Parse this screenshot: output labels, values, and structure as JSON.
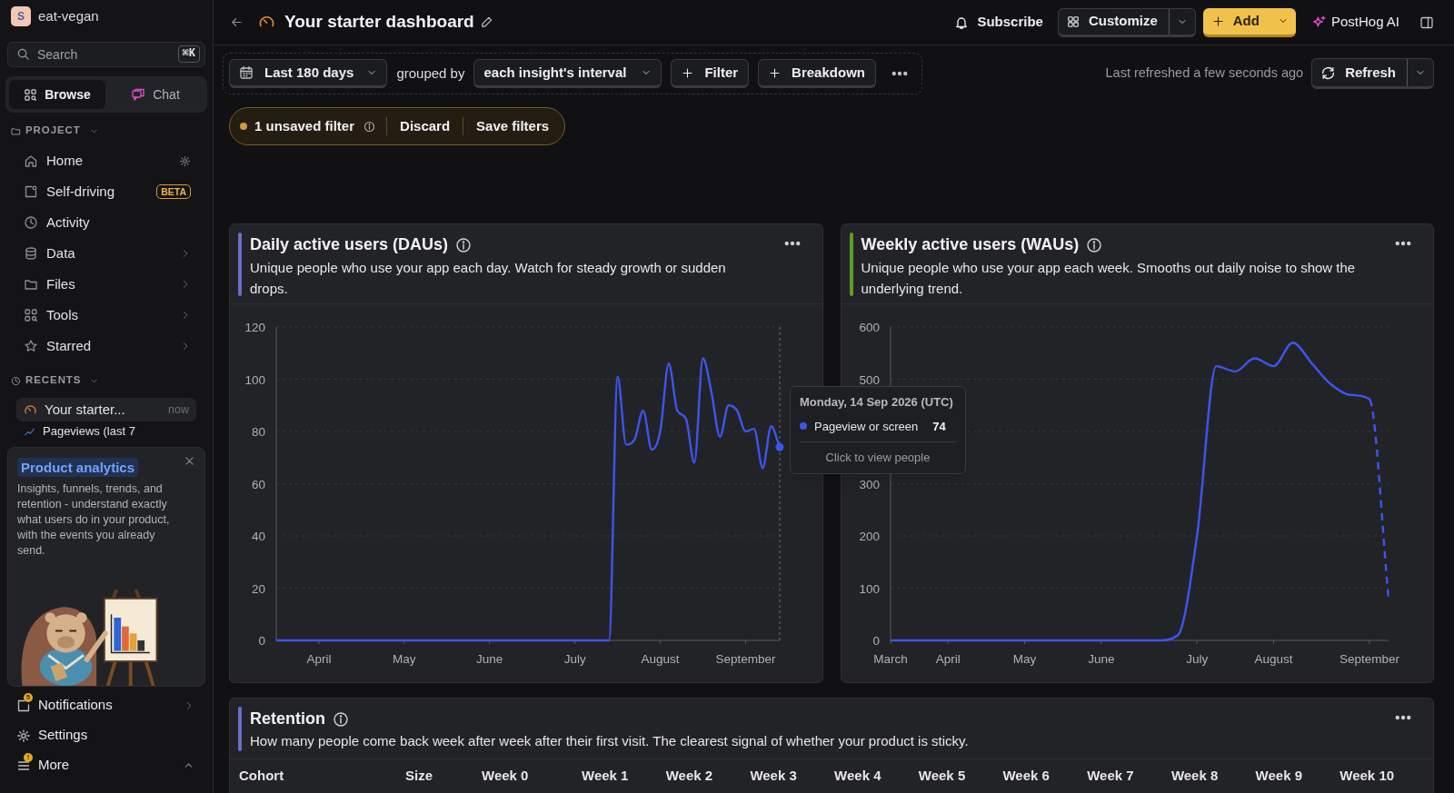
{
  "workspace": {
    "initial": "S",
    "name": "eat-vegan"
  },
  "search": {
    "placeholder": "Search",
    "shortcut": "⌘K"
  },
  "modes": [
    {
      "label": "Browse",
      "selected": true
    },
    {
      "label": "Chat",
      "selected": false
    }
  ],
  "project": {
    "label": "PROJECT",
    "expanded": true,
    "items": [
      {
        "label": "Home",
        "settings": true
      },
      {
        "label": "Self-driving",
        "badge": "BETA"
      },
      {
        "label": "Activity"
      },
      {
        "label": "Data",
        "submenu": true
      },
      {
        "label": "Files",
        "submenu": true
      },
      {
        "label": "Tools",
        "submenu": true
      },
      {
        "label": "Starred",
        "submenu": true
      }
    ]
  },
  "recents": {
    "label": "RECENTS",
    "expanded": true,
    "items": [
      {
        "label": "Your starter...",
        "time": "now",
        "selected": true
      },
      {
        "label": "Pageviews (last 7",
        "selected": false
      }
    ]
  },
  "promo": {
    "tag": "Product analytics",
    "text": "Insights, funnels, trends, and retention - understand exactly what users do in your product, with the events you already send."
  },
  "footer": [
    {
      "label": "Notifications",
      "badge": "5",
      "submenu": true
    },
    {
      "label": "Settings"
    },
    {
      "label": "More",
      "badge": "!",
      "expanded": true
    }
  ],
  "header": {
    "title": "Your starter dashboard",
    "subscribe": "Subscribe",
    "customize": "Customize",
    "add": "Add",
    "ai": "PostHog AI"
  },
  "filters": {
    "date_range": "Last 180 days",
    "grouped_by": "grouped by",
    "interval": "each insight's interval",
    "filter": "Filter",
    "breakdown": "Breakdown",
    "last_refreshed": "Last refreshed a few seconds ago",
    "refresh": "Refresh"
  },
  "unsaved": {
    "label": "1 unsaved filter",
    "discard": "Discard",
    "save": "Save filters"
  },
  "insights": [
    {
      "title": "Daily active users (DAUs)",
      "description": "Unique people who use your app each day. Watch for steady growth or sudden drops.",
      "color": "#6571c9",
      "chart_data": {
        "type": "line",
        "grid": true,
        "ylim": [
          0,
          120
        ],
        "yticks": [
          0,
          20,
          40,
          60,
          80,
          100,
          120
        ],
        "categories": [
          null,
          null,
          null,
          null,
          null,
          "April",
          null,
          null,
          null,
          null,
          null,
          null,
          null,
          null,
          null,
          "May",
          null,
          null,
          null,
          null,
          null,
          null,
          null,
          null,
          null,
          "June",
          null,
          null,
          null,
          null,
          null,
          null,
          null,
          null,
          null,
          "July",
          null,
          null,
          null,
          null,
          null,
          null,
          null,
          null,
          null,
          "August",
          null,
          null,
          null,
          null,
          null,
          null,
          null,
          null,
          null,
          "September",
          null,
          null,
          null,
          null
        ],
        "series": [
          {
            "name": "Pageview or screen",
            "color": "#3b56f0",
            "values": [
              0,
              0,
              0,
              0,
              0,
              0,
              0,
              0,
              0,
              0,
              0,
              0,
              0,
              0,
              0,
              0,
              0,
              0,
              0,
              0,
              0,
              0,
              0,
              0,
              0,
              0,
              0,
              0,
              0,
              0,
              0,
              0,
              0,
              0,
              0,
              0,
              0,
              0,
              0,
              0,
              101,
              75,
              77,
              88,
              73,
              80,
              106,
              88,
              85,
              68,
              108,
              95,
              78,
              90,
              88,
              80,
              81,
              66,
              82,
              74
            ]
          }
        ]
      },
      "hover": {
        "title": "Monday, 14 Sep 2026 (UTC)",
        "value": "74",
        "hint": "Click to view people"
      }
    },
    {
      "title": "Weekly active users (WAUs)",
      "description": "Unique people who use your app each week. Smooths out daily noise to show the underlying trend.",
      "color": "#5c9c2a",
      "chart_data": {
        "type": "line",
        "grid": true,
        "ylim": [
          0,
          600
        ],
        "yticks": [
          0,
          100,
          200,
          300,
          500,
          600
        ],
        "categories": [
          "March",
          null,
          null,
          "April",
          null,
          null,
          null,
          "May",
          null,
          null,
          null,
          "June",
          null,
          null,
          null,
          null,
          "July",
          null,
          null,
          null,
          "August",
          null,
          null,
          null,
          null,
          "September",
          null
        ],
        "series": [
          {
            "color": "#3b56f0",
            "line_style": "dashed_last_segment",
            "values": [
              0,
              0,
              0,
              0,
              0,
              0,
              0,
              0,
              0,
              0,
              0,
              0,
              0,
              0,
              0,
              10,
              200,
              525,
              515,
              540,
              525,
              570,
              530,
              490,
              470,
              462,
              80
            ]
          }
        ]
      }
    }
  ],
  "retention": {
    "title": "Retention",
    "description": "How many people come back week after week after their first visit. The clearest signal of whether your product is sticky.",
    "color": "#6571c9",
    "columns": [
      "Cohort",
      "Size",
      "Week 0",
      "Week 1",
      "Week 2",
      "Week 3",
      "Week 4",
      "Week 5",
      "Week 6",
      "Week 7",
      "Week 8",
      "Week 9",
      "Week 10"
    ]
  }
}
